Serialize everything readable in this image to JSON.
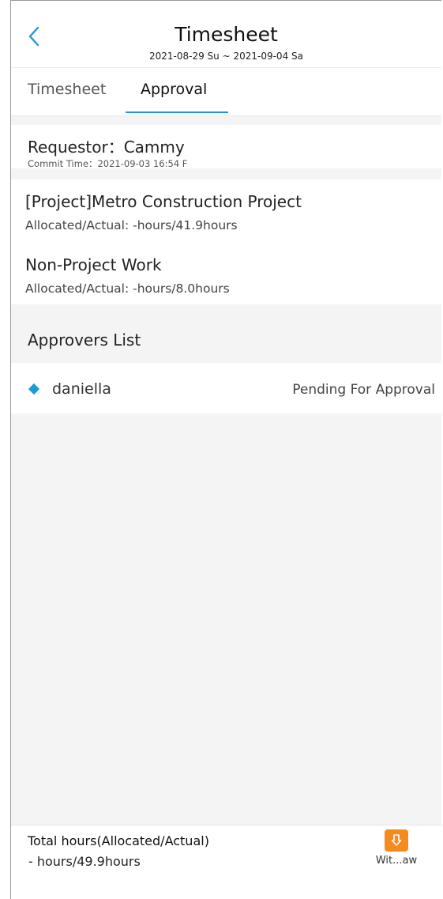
{
  "header": {
    "title": "Timesheet",
    "date_range": "2021-08-29 Su ~ 2021-09-04 Sa"
  },
  "tabs": [
    {
      "label": "Timesheet",
      "active": false
    },
    {
      "label": "Approval",
      "active": true
    }
  ],
  "request": {
    "requestor": "Requestor：Cammy",
    "commit_time": "Commit Time：2021-09-03 16:54 F"
  },
  "projects": [
    {
      "title": "[Project]Metro Construction Project",
      "hours": "Allocated/Actual:  -hours/41.9hours"
    },
    {
      "title": "Non-Project Work",
      "hours": "Allocated/Actual:  -hours/8.0hours"
    }
  ],
  "approvers": {
    "label": "Approvers List",
    "items": [
      {
        "name": "daniella",
        "status": "Pending For Approval"
      }
    ]
  },
  "footer": {
    "total_label": "Total hours(Allocated/Actual)",
    "total_value": " - hours/49.9hours",
    "withdraw_label": "Wit...aw"
  },
  "colors": {
    "accent": "#2196d6",
    "withdraw": "#f48b1f",
    "diamond": "#1a9ad6"
  }
}
